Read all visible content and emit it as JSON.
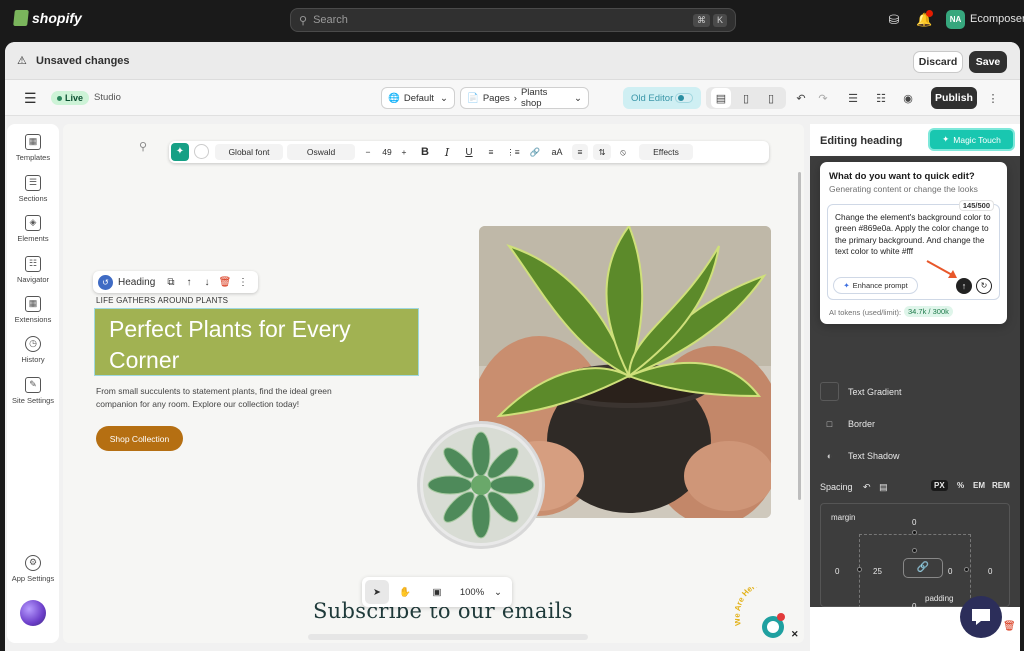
{
  "topbar": {
    "brand": "shopify",
    "search_placeholder": "Search",
    "shortcut_keys": [
      "⌘",
      "K"
    ],
    "avatar_initials": "NA",
    "store_name": "Ecomposer",
    "notification_badge": "2"
  },
  "unsaved_bar": {
    "message": "Unsaved changes",
    "discard_label": "Discard",
    "save_label": "Save"
  },
  "editor_toolbar": {
    "live_label": "Live",
    "studio_label": "Studio",
    "theme_select": "Default",
    "pages_label": "Pages",
    "page_name": "Plants shop",
    "old_editor_label": "Old Editor",
    "publish_label": "Publish"
  },
  "left_nav": {
    "items": [
      {
        "label": "Templates",
        "icon": "templates-icon"
      },
      {
        "label": "Sections",
        "icon": "sections-icon"
      },
      {
        "label": "Elements",
        "icon": "elements-icon"
      },
      {
        "label": "Navigator",
        "icon": "navigator-icon"
      },
      {
        "label": "Extensions",
        "icon": "extensions-icon"
      },
      {
        "label": "History",
        "icon": "history-icon"
      },
      {
        "label": "Site Settings",
        "icon": "brush-icon"
      }
    ],
    "app_settings_label": "App Settings"
  },
  "text_toolbar": {
    "global_font": "Global font",
    "font_name": "Oswald",
    "font_size": "49",
    "effects_label": "Effects"
  },
  "heading_controls": {
    "label": "Heading"
  },
  "page_content": {
    "kicker": "LIFE GATHERS AROUND PLANTS",
    "heading": "Perfect Plants for Every Corner",
    "paragraph": "From small succulents to statement plants, find the ideal green companion for any room. Explore our collection today!",
    "button_label": "Shop Collection",
    "subscribe_heading": "Subscribe to our emails",
    "colors": {
      "heading_bg": "#a1b252",
      "button_bg": "#b56f12"
    }
  },
  "zoom": {
    "level": "100%"
  },
  "right_panel": {
    "title": "Editing heading",
    "magic_touch_label": "Magic Touch",
    "options": [
      "Text Gradient",
      "Border",
      "Text Shadow"
    ],
    "spacing_label": "Spacing",
    "units": [
      "PX",
      "%",
      "EM",
      "REM"
    ],
    "box": {
      "margin_label": "margin",
      "padding_label": "padding",
      "margin_top": "0",
      "margin_left": "0",
      "margin_right": "0",
      "padding_top": "0",
      "padding_left": "25",
      "padding_right": "0",
      "padding_bottom": "0"
    }
  },
  "quick_edit": {
    "title": "What do you want to quick edit?",
    "subtitle": "Generating content or change the looks",
    "char_count": "145/500",
    "prompt": "Change the element's background color to green #869e0a. Apply the color change to the primary background. And change the text color to white #fff",
    "enhance_label": "Enhance prompt",
    "tokens_label": "AI tokens (used/limit):",
    "tokens_value": "34.7k / 300k"
  },
  "widget": {
    "we_are_here": "We Are Here!",
    "badge": "1"
  }
}
